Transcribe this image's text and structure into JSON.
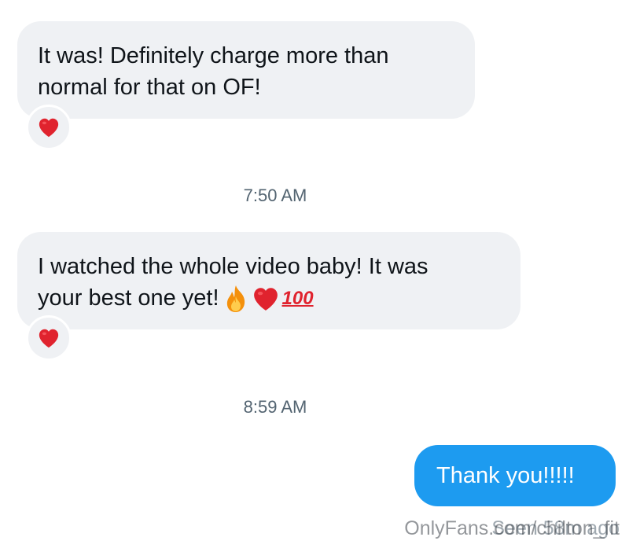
{
  "messages": [
    {
      "text": "It was! Definitely charge more than\nnormal for that on OF!",
      "direction": "incoming",
      "reaction": "red-heart"
    },
    {
      "text": "I watched the whole video baby! It was\nyour best one yet!",
      "emojis": [
        "fire",
        "red-heart",
        "100"
      ],
      "direction": "incoming",
      "reaction": "red-heart"
    },
    {
      "text": "Thank you!!!!!",
      "direction": "outgoing"
    }
  ],
  "timestamps": [
    "7:50 AM",
    "8:59 AM"
  ],
  "status": {
    "seen": "Seen 58m ago"
  },
  "watermark": "OnlyFans.com/chilton_fit",
  "emoji_100_text": "100",
  "colors": {
    "incoming_bubble": "#eff1f4",
    "outgoing_bubble": "#1d9bf0",
    "timestamp": "#536471",
    "heart": "#e0232e"
  }
}
